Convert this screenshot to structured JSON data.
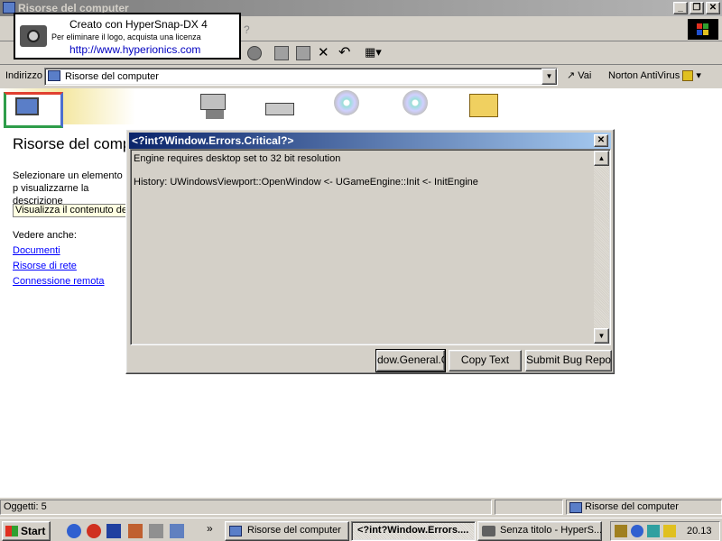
{
  "window": {
    "title": "Risorse del computer",
    "menu_help": "?"
  },
  "watermark": {
    "line1": "Creato con HyperSnap-DX 4",
    "line2": "Per eliminare il logo, acquista una licenza",
    "url": "http://www.hyperionics.com"
  },
  "address": {
    "label": "Indirizzo",
    "value": "Risorse del computer",
    "go_label": "Vai",
    "norton_label": "Norton AntiVirus"
  },
  "pane": {
    "heading": "Risorse del compu",
    "description": "Selezionare un elemento p visualizzarne la descrizione",
    "view_contents": "Visualizza il contenuto del",
    "see_also": "Vedere anche:",
    "links": [
      "Documenti",
      "Risorse di rete",
      "Connessione remota"
    ]
  },
  "drives": [
    {
      "icon": "floppy-drive-icon"
    },
    {
      "icon": "hard-disk-icon"
    },
    {
      "icon": "cd-rom-icon"
    },
    {
      "icon": "cd-rom-icon"
    },
    {
      "icon": "control-panel-folder-icon"
    }
  ],
  "dialog": {
    "title": "<?int?Window.Errors.Critical?>",
    "message": "Engine requires desktop set to 32 bit resolution",
    "history": "History: UWindowsViewport::OpenWindow <- UGameEngine::Init <- InitEngine",
    "buttons": {
      "ok": "dow.General.O",
      "copy": "Copy Text",
      "report": "Submit Bug Report"
    }
  },
  "status": {
    "objects": "Oggetti: 5",
    "location": "Risorse del computer"
  },
  "taskbar": {
    "start": "Start",
    "chevron": "»",
    "tasks": [
      {
        "label": "Risorse del computer",
        "active": false
      },
      {
        "label": "<?int?Window.Errors....",
        "active": true
      },
      {
        "label": "Senza titolo - HyperS...",
        "active": false
      }
    ],
    "clock": "20.13"
  }
}
